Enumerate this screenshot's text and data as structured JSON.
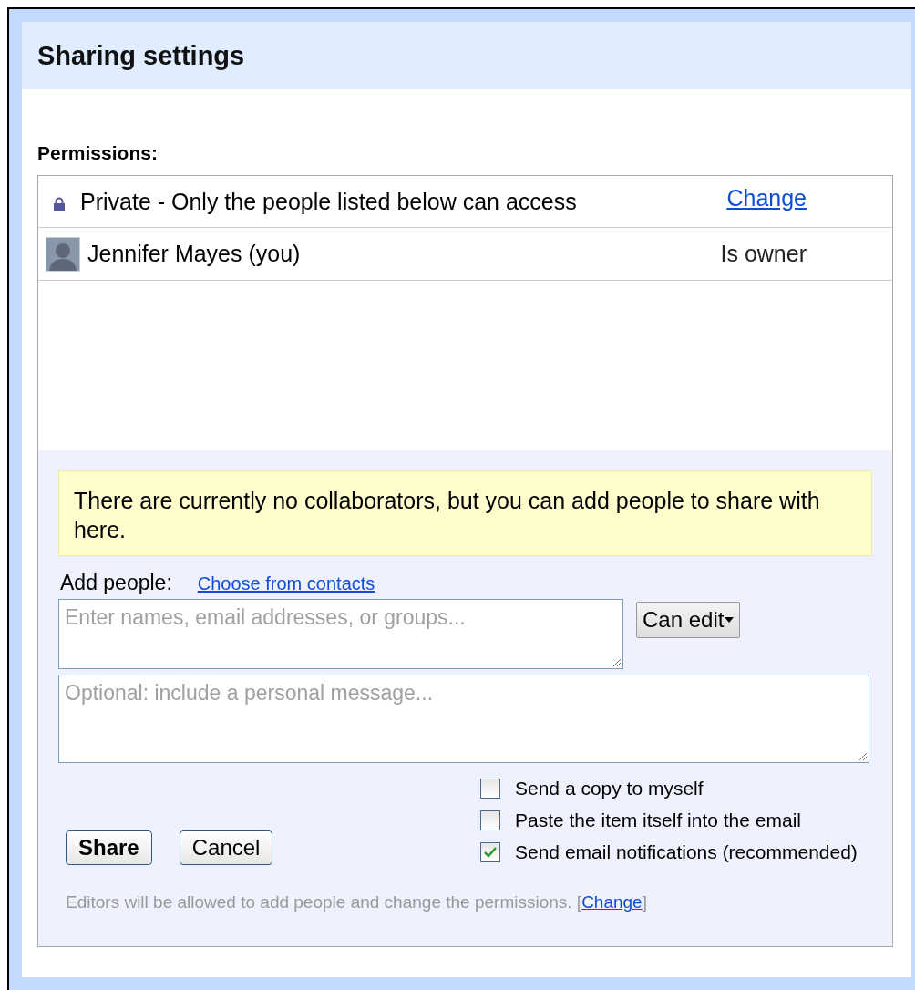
{
  "dialog": {
    "title": "Sharing settings"
  },
  "permissions": {
    "label": "Permissions:",
    "visibility": {
      "text": "Private - Only the people listed below can access",
      "link": "Change"
    },
    "people": [
      {
        "name": "Jennifer Mayes (you)",
        "role": "Is owner"
      }
    ]
  },
  "notice": "There are currently no collaborators, but you can add people to share with here.",
  "add_people": {
    "label": "Add people:",
    "link": "Choose from contacts",
    "placeholder": "Enter names, email addresses, or groups...",
    "access": "Can edit"
  },
  "message": {
    "placeholder": "Optional: include a personal message..."
  },
  "options": [
    {
      "label": "Send a copy to myself",
      "checked": false
    },
    {
      "label": "Paste the item itself into the email",
      "checked": false
    },
    {
      "label": "Send email notifications (recommended)",
      "checked": true
    }
  ],
  "buttons": [
    {
      "label": "Share",
      "kind": "primary"
    },
    {
      "label": "Cancel",
      "kind": "secondary"
    }
  ],
  "note": {
    "text": "Editors will be allowed to add people and change the permissions. [",
    "link": "Change",
    "after": "]"
  }
}
